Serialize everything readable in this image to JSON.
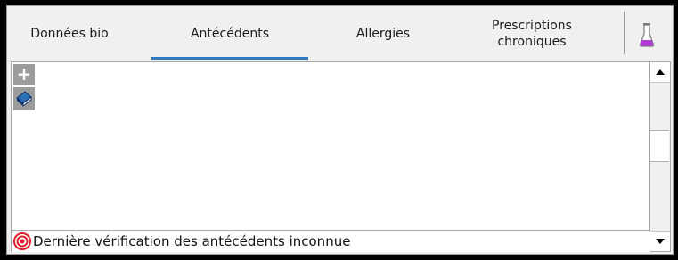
{
  "tabs": [
    {
      "label": "Données bio"
    },
    {
      "label": "Antécédents",
      "active": true
    },
    {
      "label": "Allergies"
    },
    {
      "label": "Prescriptions chroniques"
    }
  ],
  "icons": {
    "lab": "flask-icon",
    "add": "plus-icon",
    "book": "book-icon",
    "status": "target-icon",
    "scroll_up": "arrow-up-icon",
    "scroll_down": "arrow-down-icon"
  },
  "add_button_glyph": "+",
  "status": {
    "text": "Dernière vérification des antécédents inconnue",
    "color": "#e0202a"
  },
  "colors": {
    "active_tab_underline": "#2f7bc1",
    "flask": "#b23ad6"
  }
}
